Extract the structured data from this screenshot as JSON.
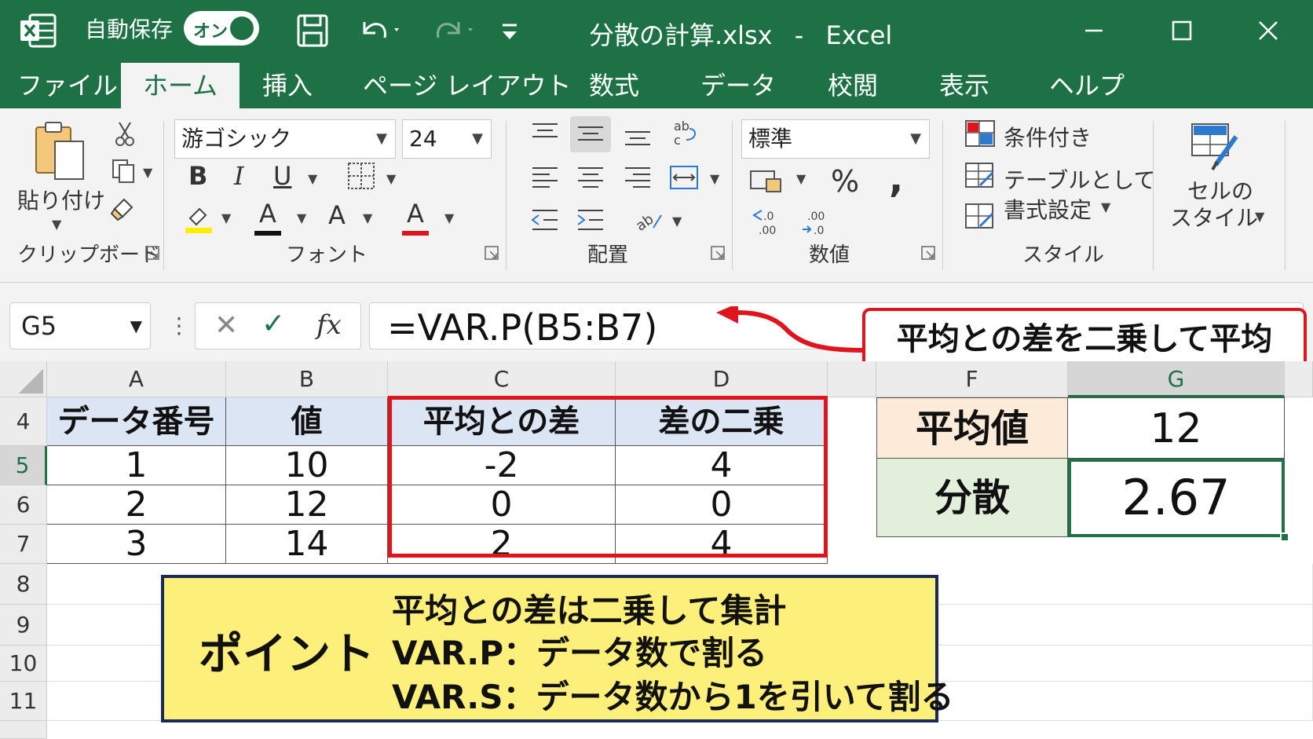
{
  "titlebar": {
    "autosave_label": "自動保存",
    "autosave_state": "オン",
    "document_title": "分散の計算.xlsx",
    "separator": "-",
    "app_name": "Excel"
  },
  "menu": {
    "tabs": [
      "ファイル",
      "ホーム",
      "挿入",
      "ページ レイアウト",
      "数式",
      "データ",
      "校閲",
      "表示",
      "ヘルプ"
    ],
    "active": "ホーム"
  },
  "ribbon": {
    "clipboard": {
      "group_label": "クリップボード",
      "paste_label": "貼り付け"
    },
    "font": {
      "group_label": "フォント",
      "font_name": "游ゴシック",
      "font_size": "24",
      "bold": "B",
      "italic": "I",
      "underline": "U",
      "font_color_glyph": "A",
      "size_glyph": "A"
    },
    "alignment": {
      "group_label": "配置"
    },
    "number": {
      "group_label": "数値",
      "format": "標準",
      "percent": "%",
      "comma": ","
    },
    "styles": {
      "group_label": "スタイル",
      "conditional": "条件付き",
      "table_format_1": "テーブルとして",
      "table_format_2": "書式設定",
      "cell_styles_1": "セルの",
      "cell_styles_2": "スタイル"
    }
  },
  "formula_bar": {
    "name_box": "G5",
    "formula": "=VAR.P(B5:B7)",
    "fx": "fx"
  },
  "callout": {
    "text": "平均との差を二乗して平均"
  },
  "grid": {
    "columns": [
      "A",
      "B",
      "C",
      "D",
      "",
      "F",
      "G"
    ],
    "rows": [
      "4",
      "5",
      "6",
      "7",
      "8",
      "9",
      "10",
      "11"
    ],
    "table": {
      "headers": [
        "データ番号",
        "値",
        "平均との差",
        "差の二乗"
      ],
      "rows": [
        [
          "1",
          "10",
          "-2",
          "4"
        ],
        [
          "2",
          "12",
          "0",
          "0"
        ],
        [
          "3",
          "14",
          "2",
          "4"
        ]
      ]
    },
    "summary": {
      "mean_label": "平均値",
      "mean_value": "12",
      "variance_label": "分散",
      "variance_value": "2.67"
    }
  },
  "point": {
    "title": "ポイント",
    "lines": [
      "平均との差は二乗して集計",
      "VAR.P：データ数で割る",
      "VAR.S：データ数から1を引いて割る"
    ]
  },
  "colors": {
    "excel_green": "#1e7145",
    "header_blue": "#dbe5f3",
    "mean_bg": "#fcebd9",
    "variance_bg": "#e2efda",
    "callout_red": "#e0141c",
    "point_yellow": "#fdf07a"
  }
}
